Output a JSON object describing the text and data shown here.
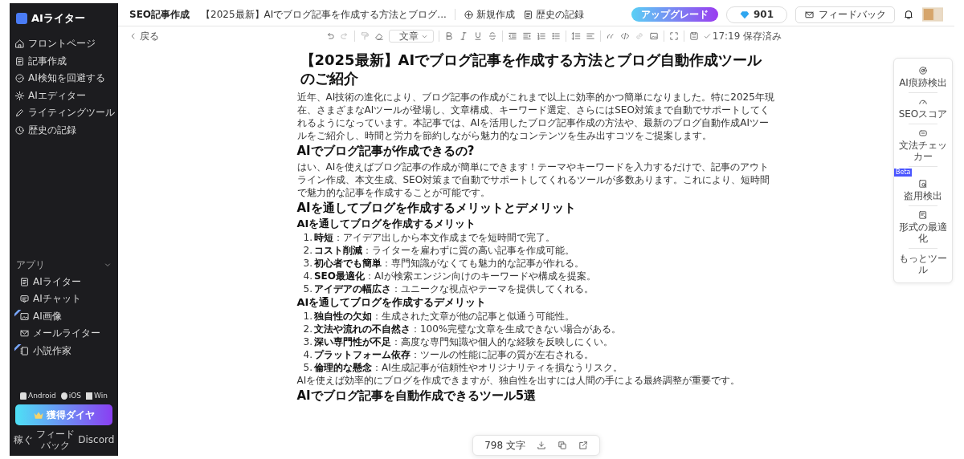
{
  "sidebar": {
    "logo": "AIライター",
    "nav": [
      {
        "label": "フロントページ"
      },
      {
        "label": "記事作成"
      },
      {
        "label": "AI検知を回避する"
      },
      {
        "label": "AIエディター"
      },
      {
        "label": "ライティングツール"
      },
      {
        "label": "歴史の記録"
      }
    ],
    "apps_heading": "アプリ",
    "apps": [
      {
        "label": "AIライター",
        "badge": false
      },
      {
        "label": "AIチャット",
        "badge": false
      },
      {
        "label": "AI画像",
        "badge": true
      },
      {
        "label": "メールライター",
        "badge": false
      },
      {
        "label": "小説作家",
        "badge": true
      }
    ],
    "platforms": [
      "Android",
      "iOS",
      "Win"
    ],
    "cta": "獲得ダイヤ",
    "footer_links": [
      "稼ぐ",
      "フィードバック",
      "Discord"
    ]
  },
  "topbar": {
    "section": "SEO記事作成",
    "doc_title": "【2025最新】AIでブログ記事を作成する方法とブログ...",
    "actions": [
      "新規作成",
      "歴史の記録"
    ],
    "upgrade": "アップグレード",
    "diamonds": "901",
    "feedback": "フィードバック"
  },
  "toolbar": {
    "back": "戻る",
    "style_select": "文章",
    "save_status": "17:19 保存済み"
  },
  "article": {
    "title": "【2025最新】AIでブログ記事を作成する方法とブログ自動作成ツールのご紹介",
    "blocks": [
      {
        "kind": "p",
        "text": "近年、AI技術の進化により、ブログ記事の作成がこれまで以上に効率的かつ簡単になりました。特に2025年現在、さまざまなAIツールが登場し、文章構成、キーワード選定、さらにはSEO対策まで自動でサポートしてくれるようになっています。本記事では、AIを活用したブログ記事作成の方法や、最新のブログ自動作成AIツールをご紹介し、時間と労力を節約しながら魅力的なコンテンツを生み出すコツをご提案します。"
      },
      {
        "kind": "h2",
        "text": "AIでブログ記事が作成できるの?"
      },
      {
        "kind": "p",
        "text": "はい、AIを使えばブログ記事の作成が簡単にできます！テーマやキーワードを入力するだけで、記事のアウトライン作成、本文生成、SEO対策まで自動でサポートしてくれるツールが多数あります。これにより、短時間で魅力的な記事を作成することが可能です。"
      },
      {
        "kind": "h2",
        "text": "AIを通してブログを作成するメリットとデメリット"
      },
      {
        "kind": "h3",
        "text": "AIを通してブログを作成するメリット"
      },
      {
        "kind": "ol",
        "items": [
          {
            "number": "1.",
            "text": "**時短**：アイデア出しから本文作成までを短時間で完了。"
          },
          {
            "number": "2.",
            "text": "**コスト削減**：ライターを雇わずに質の高い記事を作成可能。"
          },
          {
            "number": "3.",
            "text": "**初心者でも簡単**：専門知識がなくても魅力的な記事が作れる。"
          },
          {
            "number": "4.",
            "text": "**SEO最適化**：AIが検索エンジン向けのキーワードや構成を提案。"
          },
          {
            "number": "5.",
            "text": "**アイデアの幅広さ**：ユニークな視点やテーマを提供してくれる。"
          }
        ]
      },
      {
        "kind": "h3",
        "text": "AIを通してブログを作成するデメリット"
      },
      {
        "kind": "ol",
        "items": [
          {
            "number": "1.",
            "text": "**独自性の欠如**：生成された文章が他の記事と似通う可能性。"
          },
          {
            "number": "2.",
            "text": "**文法や流れの不自然さ**：100%完璧な文章を生成できない場合がある。"
          },
          {
            "number": "3.",
            "text": "**深い専門性が不足**：高度な専門知識や個人的な経験を反映しにくい。"
          },
          {
            "number": "4.",
            "text": "**プラットフォーム依存**：ツールの性能に記事の質が左右される。"
          },
          {
            "number": "5.",
            "text": "**倫理的な懸念**：AI生成記事が信頼性やオリジナリティを損なうリスク。"
          }
        ]
      },
      {
        "kind": "p",
        "text": "AIを使えば効率的にブログを作成できますが、独自性を出すには人間の手による最終調整が重要です。"
      },
      {
        "kind": "h2",
        "text": "AIでブログ記事を自動作成できるツール5選"
      }
    ]
  },
  "word_count": "798 文字",
  "tools": [
    {
      "label": "AI痕跡検出",
      "beta": false
    },
    {
      "label": "SEOスコア",
      "beta": false
    },
    {
      "label": "文法チェッカー",
      "beta": false
    },
    {
      "label": "盗用検出",
      "beta": true
    },
    {
      "label": "形式の最適化",
      "beta": false
    },
    {
      "label": "もっとツール",
      "beta": false
    }
  ],
  "beta_label": "Beta"
}
